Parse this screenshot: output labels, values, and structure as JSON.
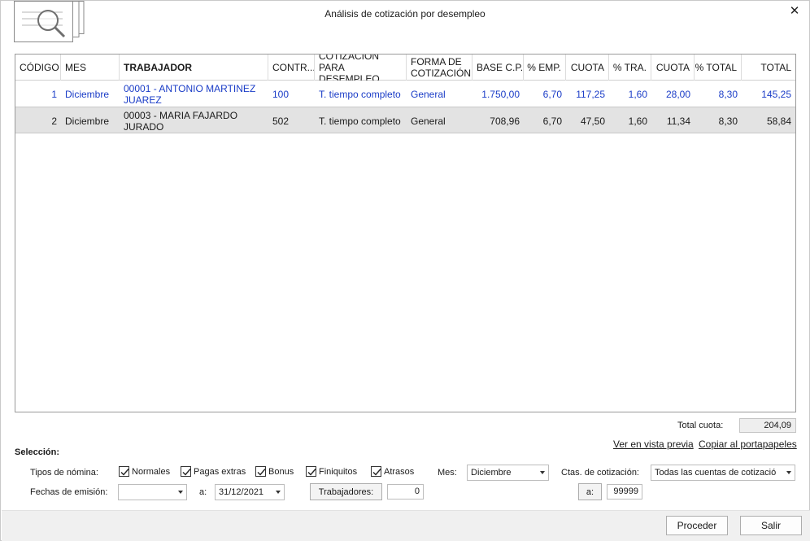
{
  "window": {
    "title": "Análisis de cotización por desempleo"
  },
  "icons": {
    "header": "report-magnifier-icon",
    "close": "close-icon",
    "dropdown": "chevron-down-icon",
    "check": "checkmark-icon"
  },
  "colors": {
    "accent_text": "#1a3cc7",
    "selected_row": "#e3e3e3"
  },
  "table": {
    "columns": [
      "CÓDIGO",
      "MES",
      "TRABAJADOR",
      "CONTR...",
      "COTIZACIÓN PARA DESEMPLEO",
      "FORMA DE COTIZACIÓN",
      "BASE C.P.",
      "% EMP.",
      "CUOTA",
      "% TRA.",
      "CUOTA",
      "% TOTAL",
      "TOTAL"
    ],
    "rows": [
      [
        "1",
        "Diciembre",
        "00001 - ANTONIO MARTINEZ JUAREZ",
        "100",
        "T. tiempo completo",
        "General",
        "1.750,00",
        "6,70",
        "117,25",
        "1,60",
        "28,00",
        "8,30",
        "145,25"
      ],
      [
        "2",
        "Diciembre",
        "00003 - MARIA FAJARDO JURADO",
        "502",
        "T. tiempo completo",
        "General",
        "708,96",
        "6,70",
        "47,50",
        "1,60",
        "11,34",
        "8,30",
        "58,84"
      ]
    ]
  },
  "totals": {
    "label": "Total cuota:",
    "value": "204,09"
  },
  "links": {
    "preview": "Ver en vista previa",
    "copy": "Copiar al portapapeles"
  },
  "selection": {
    "title": "Selección:",
    "tipos_label": "Tipos de nómina:",
    "checks": [
      {
        "label": "Normales",
        "checked": true
      },
      {
        "label": "Pagas extras",
        "checked": true
      },
      {
        "label": "Bonus",
        "checked": true
      },
      {
        "label": "Finiquitos",
        "checked": true
      },
      {
        "label": "Atrasos",
        "checked": true
      }
    ],
    "mes_label": "Mes:",
    "mes_value": "Diciembre",
    "ctas_label": "Ctas. de cotización:",
    "ctas_value": "Todas las cuentas de cotizació",
    "fechas_label": "Fechas de emisión:",
    "fecha_desde": "",
    "a_label": "a:",
    "fecha_hasta": "31/12/2021",
    "trabajadores_button": "Trabajadores:",
    "trabajadores_desde": "0",
    "a_button": "a:",
    "trabajadores_hasta": "99999"
  },
  "buttons": {
    "proceed": "Proceder",
    "exit": "Salir"
  }
}
